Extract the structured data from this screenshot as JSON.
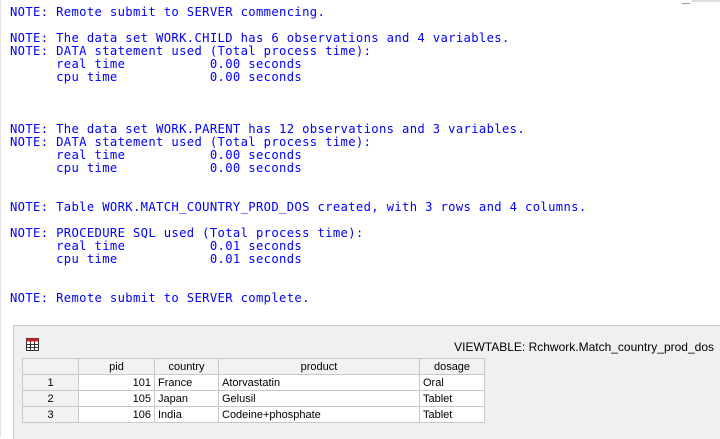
{
  "log": {
    "lines": [
      "NOTE: Remote submit to SERVER commencing.",
      "NOTE: The data set WORK.CHILD has 6 observations and 4 variables.",
      "NOTE: DATA statement used (Total process time):",
      "      real time           0.00 seconds",
      "      cpu time            0.00 seconds",
      "NOTE: The data set WORK.PARENT has 12 observations and 3 variables.",
      "NOTE: DATA statement used (Total process time):",
      "      real time           0.00 seconds",
      "      cpu time            0.00 seconds",
      "NOTE: Table WORK.MATCH_COUNTRY_PROD_DOS created, with 3 rows and 4 columns.",
      "NOTE: PROCEDURE SQL used (Total process time):",
      "      real time           0.01 seconds",
      "      cpu time            0.01 seconds",
      "NOTE: Remote submit to SERVER complete."
    ],
    "text_color": "#0000ff"
  },
  "viewtable": {
    "title": "VIEWTABLE: Rchwork.Match_country_prod_dos",
    "icon": "table-icon",
    "columns": [
      "",
      "pid",
      "country",
      "product",
      "dosage"
    ],
    "rows": [
      {
        "n": "1",
        "pid": "101",
        "country": "France",
        "product": "Atorvastatin",
        "dosage": "Oral"
      },
      {
        "n": "2",
        "pid": "105",
        "country": "Japan",
        "product": "Gelusil",
        "dosage": "Tablet"
      },
      {
        "n": "3",
        "pid": "106",
        "country": "India",
        "product": "Codeine+phosphate",
        "dosage": "Tablet"
      }
    ]
  }
}
